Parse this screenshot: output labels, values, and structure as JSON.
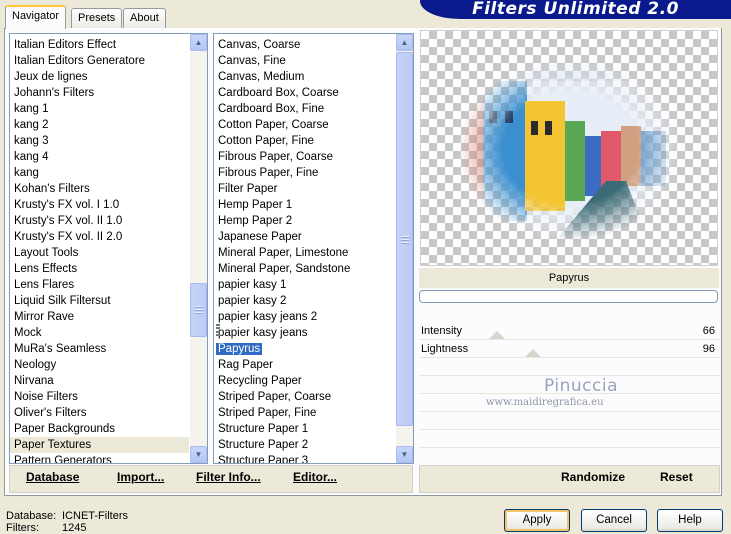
{
  "tabs": [
    {
      "label": "Navigator",
      "active": true
    },
    {
      "label": "Presets",
      "active": false
    },
    {
      "label": "About",
      "active": false
    }
  ],
  "title": "Filters Unlimited 2.0",
  "categories": {
    "items": [
      "Italian Editors Effect",
      "Italian Editors Generatore",
      "Jeux de lignes",
      "Johann's Filters",
      "kang 1",
      "kang 2",
      "kang 3",
      "kang 4",
      "kang",
      "Kohan's Filters",
      "Krusty's FX vol. I 1.0",
      "Krusty's FX vol. II 1.0",
      "Krusty's FX vol. II 2.0",
      "Layout Tools",
      "Lens Effects",
      "Lens Flares",
      "Liquid Silk Filtersut",
      "Mirror Rave",
      "Mock",
      "MuRa's Seamless",
      "Neology",
      "Nirvana",
      "Noise Filters",
      "Oliver's Filters",
      "Paper Backgrounds",
      "Paper Textures",
      "Pattern Generators"
    ],
    "selected": "Paper Textures"
  },
  "filters": {
    "items": [
      "Canvas, Coarse",
      "Canvas, Fine",
      "Canvas, Medium",
      "Cardboard Box, Coarse",
      "Cardboard Box, Fine",
      "Cotton Paper, Coarse",
      "Cotton Paper, Fine",
      "Fibrous Paper, Coarse",
      "Fibrous Paper, Fine",
      "Filter Paper",
      "Hemp Paper 1",
      "Hemp Paper 2",
      "Japanese Paper",
      "Mineral Paper, Limestone",
      "Mineral Paper, Sandstone",
      "papier kasy 1",
      "papier kasy 2",
      "papier kasy jeans 2",
      "papier kasy jeans",
      "Papyrus",
      "Rag Paper",
      "Recycling Paper",
      "Striped Paper, Coarse",
      "Striped Paper, Fine",
      "Structure Paper 1",
      "Structure Paper 2",
      "Structure Paper 3"
    ],
    "selected": "Papyrus"
  },
  "links": {
    "database": "Database",
    "import": "Import...",
    "filter_info": "Filter Info...",
    "editor": "Editor...",
    "randomize": "Randomize",
    "reset": "Reset"
  },
  "current_filter": "Papyrus",
  "params": [
    {
      "name": "Intensity",
      "value": "66",
      "level": 0.26
    },
    {
      "name": "Lightness",
      "value": "96",
      "level": 0.38
    }
  ],
  "watermark": {
    "name": "Pinuccia",
    "url": "www.maidiregrafica.eu"
  },
  "status": {
    "database_label": "Database:",
    "database_value": "ICNET-Filters",
    "filters_label": "Filters:",
    "filters_value": "1245"
  },
  "buttons": {
    "apply": "Apply",
    "cancel": "Cancel",
    "help": "Help"
  },
  "colors": {
    "banner": "#0a1a8c",
    "selection": "#316ac5"
  }
}
